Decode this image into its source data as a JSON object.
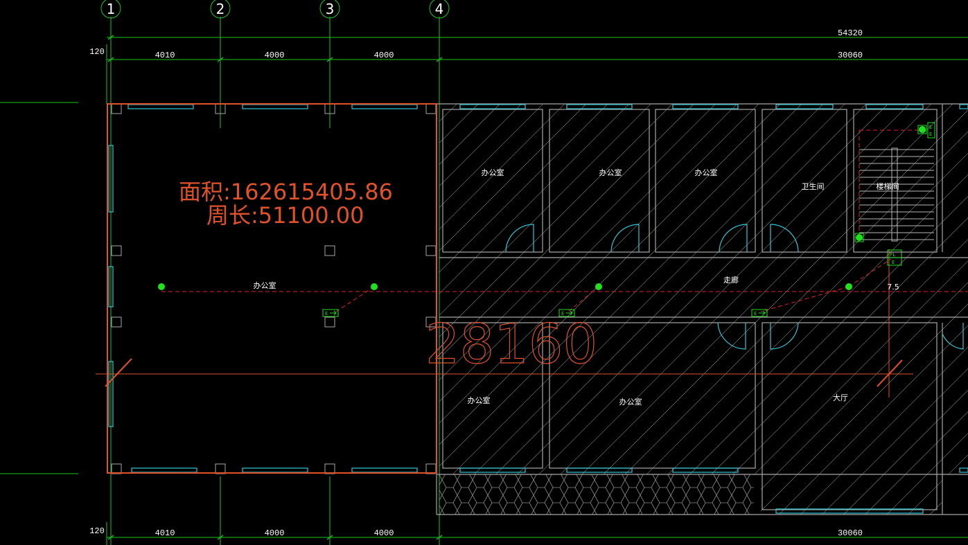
{
  "axes": [
    "1",
    "2",
    "3",
    "4"
  ],
  "dims_top": {
    "total": "54320",
    "offset": "120",
    "segments": [
      "4010",
      "4000",
      "4000",
      "30060"
    ]
  },
  "dims_bottom": {
    "offset": "120",
    "segments": [
      "4010",
      "4000",
      "4000",
      "30060"
    ]
  },
  "measurement": {
    "area": "面积:162615405.86",
    "perimeter": "周长:51100.00"
  },
  "big_dimension": "28160",
  "rooms": {
    "office_left": "办公室",
    "office_top_1": "办公室",
    "office_top_2": "办公室",
    "office_top_3": "办公室",
    "toilet": "卫生间",
    "stair": "楼梯间",
    "corridor": "走廊",
    "office_bottom_1": "办公室",
    "office_bottom_2": "办公室",
    "hall": "大厅"
  },
  "markers": {
    "exit": "E",
    "fl": "FL",
    "exit2": "E",
    "slope": "7.5"
  },
  "colors": {
    "grid": "#18c818",
    "wall": "#a8a8a8",
    "window": "#2ec8d8",
    "selection": "#e0522a",
    "evac": "#e02020",
    "lamp": "#20e020"
  }
}
